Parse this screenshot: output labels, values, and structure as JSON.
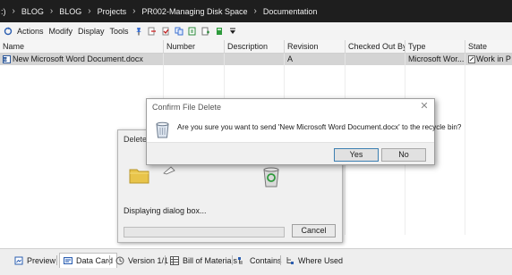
{
  "breadcrumb": {
    "root": ":)",
    "items": [
      "BLOG",
      "BLOG",
      "Projects",
      "PR002-Managing Disk Space",
      "Documentation"
    ]
  },
  "toolbar": {
    "menus": [
      "Actions",
      "Modify",
      "Display",
      "Tools"
    ]
  },
  "grid": {
    "columns": [
      "Name",
      "Number",
      "Description",
      "Revision",
      "Checked Out By",
      "Type",
      "State"
    ],
    "rows": [
      {
        "name": "New Microsoft Word Document.docx",
        "number": "",
        "description": "",
        "revision": "A",
        "checked_out_by": "",
        "type": "Microsoft Wor...",
        "state": "Work in P"
      }
    ]
  },
  "tabs": [
    {
      "label": "Preview",
      "icon": "preview-icon",
      "active": false
    },
    {
      "label": "Data Card",
      "icon": "data-card-icon",
      "active": true
    },
    {
      "label": "Version 1/1",
      "icon": "version-icon",
      "active": false
    },
    {
      "label": "Bill of Materials",
      "icon": "bom-icon",
      "active": false
    },
    {
      "label": "Contains",
      "icon": "contains-icon",
      "active": false
    },
    {
      "label": "Where Used",
      "icon": "where-used-icon",
      "active": false
    }
  ],
  "delete_dialog": {
    "title": "Delete",
    "status": "Displaying dialog box...",
    "cancel_label": "Cancel",
    "progress": 0
  },
  "confirm_dialog": {
    "title": "Confirm File Delete",
    "message": "Are you sure you want to send 'New Microsoft Word Document.docx' to the recycle bin?",
    "yes_label": "Yes",
    "no_label": "No"
  },
  "colors": {
    "breadcrumb_bg": "#1e1e1e",
    "selected_row": "#d4d4d4",
    "dialog_bg": "#f0f0f0"
  }
}
